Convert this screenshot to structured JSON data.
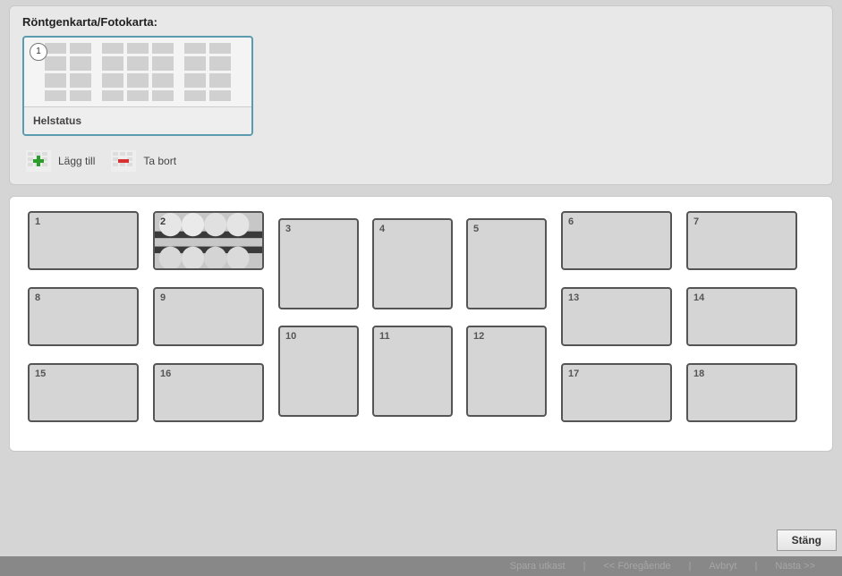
{
  "panelTitle": "Röntgenkarta/Fotokarta:",
  "card": {
    "badge": "1",
    "label": "Helstatus"
  },
  "toolbar": {
    "add": "Lägg till",
    "remove": "Ta bort"
  },
  "slots": {
    "s1": "1",
    "s2": "2",
    "s3": "3",
    "s4": "4",
    "s5": "5",
    "s6": "6",
    "s7": "7",
    "s8": "8",
    "s9": "9",
    "s10": "10",
    "s11": "11",
    "s12": "12",
    "s13": "13",
    "s14": "14",
    "s15": "15",
    "s16": "16",
    "s17": "17",
    "s18": "18"
  },
  "footer": {
    "close": "Stäng"
  },
  "bottombar": {
    "draft": "Spara utkast",
    "prev": "<< Föregående",
    "cancel": "Avbryt",
    "next": "Nästa >>"
  }
}
